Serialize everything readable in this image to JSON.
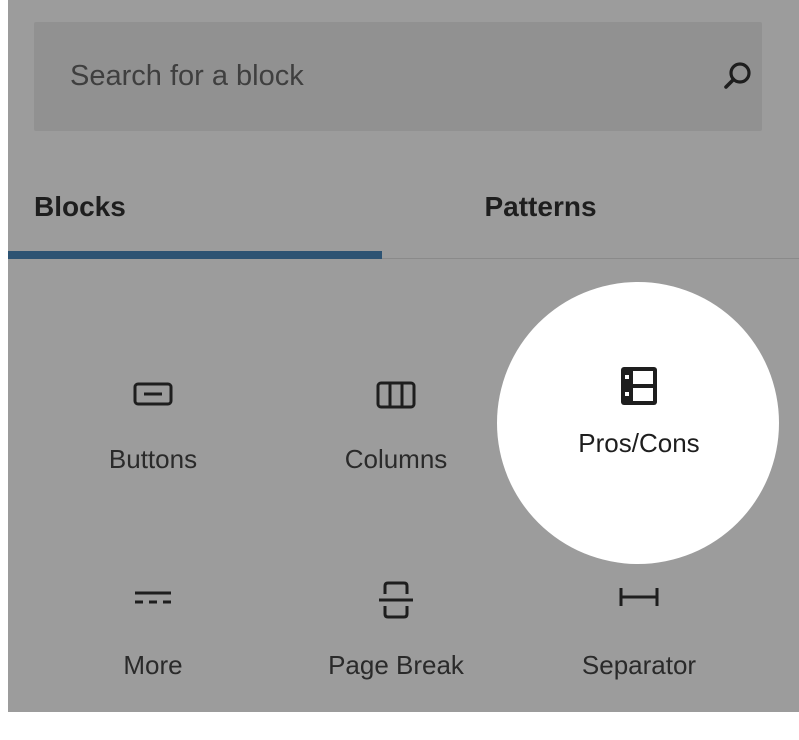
{
  "search": {
    "placeholder": "Search for a block"
  },
  "tabs": [
    {
      "label": "Blocks",
      "active": true
    },
    {
      "label": "Patterns",
      "active": false
    }
  ],
  "blocks": [
    {
      "label": "Buttons",
      "icon": "buttons-icon"
    },
    {
      "label": "Columns",
      "icon": "columns-icon"
    },
    {
      "label": "Pros/Cons",
      "icon": "pros-cons-icon",
      "highlighted": true
    },
    {
      "label": "More",
      "icon": "more-icon"
    },
    {
      "label": "Page Break",
      "icon": "page-break-icon"
    },
    {
      "label": "Separator",
      "icon": "separator-icon"
    }
  ],
  "colors": {
    "panel_background": "#9c9c9c",
    "search_background": "#919191",
    "tab_indicator": "#2d5373",
    "highlight": "#ffffff"
  }
}
